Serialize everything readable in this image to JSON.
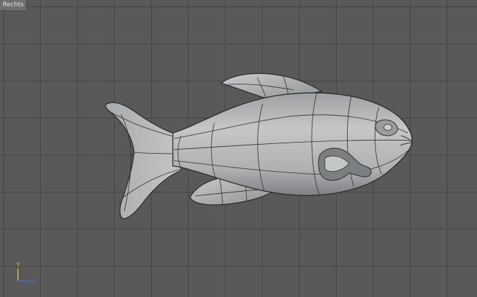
{
  "viewport": {
    "label": "Rechts",
    "background_color": "#595959",
    "grid_color": "#454545",
    "grid_major_color": "#3d3d3d"
  },
  "model": {
    "icon": "fish-mesh-icon",
    "fill_color": "#b8babb",
    "shade_color": "#8c8f91",
    "wire_color": "#2a2a2a"
  },
  "axis_gizmo": {
    "y_label": "Y",
    "z_label": "Z",
    "y_color": "#e0c040",
    "z_color": "#3b6de0"
  }
}
